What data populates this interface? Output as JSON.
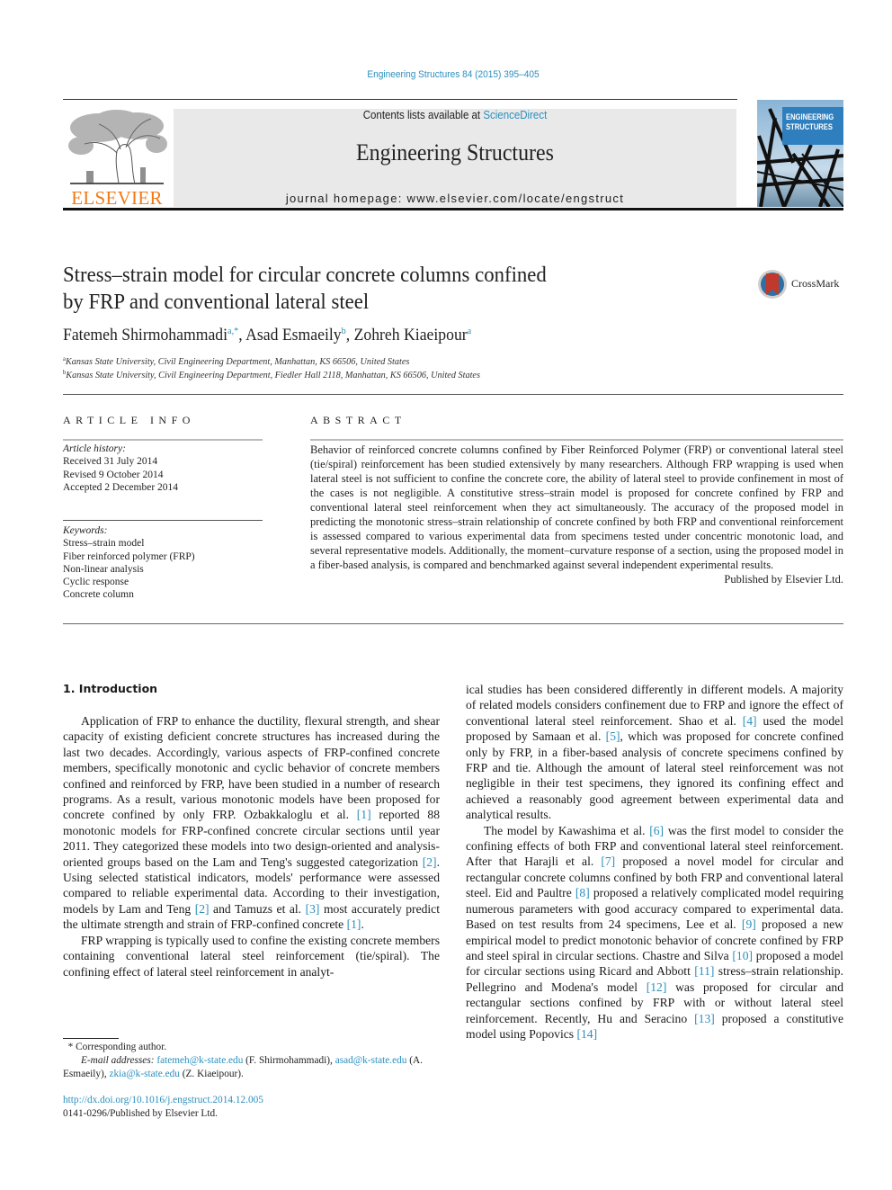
{
  "header": {
    "journal_ref": "Engineering Structures 84 (2015) 395–405",
    "contents_prefix": "Contents lists available at ",
    "contents_link": "ScienceDirect",
    "journal_name": "Engineering Structures",
    "homepage": "journal homepage: www.elsevier.com/locate/engstruct",
    "publisher_logo": "ELSEVIER",
    "cover_title_line1": "ENGINEERING",
    "cover_title_line2": "STRUCTURES",
    "crossmark_label": "CrossMark"
  },
  "article": {
    "title_line1": "Stress–strain model for circular concrete columns confined",
    "title_line2": "by FRP and conventional lateral steel",
    "authors": [
      {
        "name": "Fatemeh Shirmohammadi",
        "sup": "a,*"
      },
      {
        "name": "Asad Esmaeily",
        "sup": "b"
      },
      {
        "name": "Zohreh Kiaeipour",
        "sup": "a"
      }
    ],
    "affiliations": [
      {
        "key": "a",
        "text": "Kansas State University, Civil Engineering Department, Manhattan, KS 66506, United States"
      },
      {
        "key": "b",
        "text": "Kansas State University, Civil Engineering Department, Fiedler Hall 2118, Manhattan, KS 66506, United States"
      }
    ]
  },
  "article_info": {
    "heading": "ARTICLE INFO",
    "history_label": "Article history:",
    "history": [
      "Received 31 July 2014",
      "Revised 9 October 2014",
      "Accepted 2 December 2014"
    ],
    "keywords_label": "Keywords:",
    "keywords": [
      "Stress–strain model",
      "Fiber reinforced polymer (FRP)",
      "Non-linear analysis",
      "Cyclic response",
      "Concrete column"
    ]
  },
  "abstract": {
    "heading": "ABSTRACT",
    "text": "Behavior of reinforced concrete columns confined by Fiber Reinforced Polymer (FRP) or conventional lateral steel (tie/spiral) reinforcement has been studied extensively by many researchers. Although FRP wrapping is used when lateral steel is not sufficient to confine the concrete core, the ability of lateral steel to provide confinement in most of the cases is not negligible. A constitutive stress–strain model is proposed for concrete confined by FRP and conventional lateral steel reinforcement when they act simultaneously. The accuracy of the proposed model in predicting the monotonic stress–strain relationship of concrete confined by both FRP and conventional reinforcement is assessed compared to various experimental data from specimens tested under concentric monotonic load, and several representative models. Additionally, the moment–curvature response of a section, using the proposed model in a fiber-based analysis, is compared and benchmarked against several independent experimental results.",
    "published_by": "Published by Elsevier Ltd."
  },
  "body": {
    "section_heading": "1. Introduction",
    "left_paragraphs": [
      [
        {
          "t": "Application of FRP to enhance the ductility, flexural strength, and shear capacity of existing deficient concrete structures has increased during the last two decades. Accordingly, various aspects of FRP-confined concrete members, specifically monotonic and cyclic behavior of concrete members confined and reinforced by FRP, have been studied in a number of research programs. As a result, various monotonic models have been proposed for concrete confined by only FRP. Ozbakkaloglu et al. "
        },
        {
          "ref": "[1]"
        },
        {
          "t": " reported 88 monotonic models for FRP-confined concrete circular sections until year 2011. They categorized these models into two design-oriented and analysis-oriented groups based on the Lam and Teng's suggested categorization "
        },
        {
          "ref": "[2]"
        },
        {
          "t": ". Using selected statistical indicators, models' performance were assessed compared to reliable experimental data. According to their investigation, models by Lam and Teng "
        },
        {
          "ref": "[2]"
        },
        {
          "t": " and Tamuzs et al. "
        },
        {
          "ref": "[3]"
        },
        {
          "t": " most accurately predict the ultimate strength and strain of FRP-confined concrete "
        },
        {
          "ref": "[1]"
        },
        {
          "t": "."
        }
      ],
      [
        {
          "t": "FRP wrapping is typically used to confine the existing concrete members containing conventional lateral steel reinforcement (tie/spiral). The confining effect of lateral steel reinforcement in analyt-"
        }
      ]
    ],
    "right_paragraphs": [
      [
        {
          "t": "ical studies has been considered differently in different models. A majority of related models considers confinement due to FRP and ignore the effect of conventional lateral steel reinforcement. Shao et al. "
        },
        {
          "ref": "[4]"
        },
        {
          "t": " used the model proposed by Samaan et al. "
        },
        {
          "ref": "[5]"
        },
        {
          "t": ", which was proposed for concrete confined only by FRP, in a fiber-based analysis of concrete specimens confined by FRP and tie. Although the amount of lateral steel reinforcement was not negligible in their test specimens, they ignored its confining effect and achieved a reasonably good agreement between experimental data and analytical results."
        }
      ],
      [
        {
          "t": "The model by Kawashima et al. "
        },
        {
          "ref": "[6]"
        },
        {
          "t": " was the first model to consider the confining effects of both FRP and conventional lateral steel reinforcement. After that Harajli et al. "
        },
        {
          "ref": "[7]"
        },
        {
          "t": " proposed a novel model for circular and rectangular concrete columns confined by both FRP and conventional lateral steel. Eid and Paultre "
        },
        {
          "ref": "[8]"
        },
        {
          "t": " proposed a relatively complicated model requiring numerous parameters with good accuracy compared to experimental data. Based on test results from 24 specimens, Lee et al. "
        },
        {
          "ref": "[9]"
        },
        {
          "t": " proposed a new empirical model to predict monotonic behavior of concrete confined by FRP and steel spiral in circular sections. Chastre and Silva "
        },
        {
          "ref": "[10]"
        },
        {
          "t": " proposed a model for circular sections using Ricard and Abbott "
        },
        {
          "ref": "[11]"
        },
        {
          "t": " stress–strain relationship. Pellegrino and Modena's model "
        },
        {
          "ref": "[12]"
        },
        {
          "t": " was proposed for circular and rectangular sections confined by FRP with or without lateral steel reinforcement. Recently, Hu and Seracino "
        },
        {
          "ref": "[13]"
        },
        {
          "t": " proposed a constitutive model using Popovics "
        },
        {
          "ref": "[14]"
        }
      ]
    ]
  },
  "footnotes": {
    "corresponding_marker": "*",
    "corresponding_text": "Corresponding author.",
    "email_label": "E-mail addresses:",
    "emails": [
      {
        "email": "fatemeh@k-state.edu",
        "name": "(F. Shirmohammadi)"
      },
      {
        "email": "asad@k-state.edu",
        "name": "(A. Esmaeily)"
      },
      {
        "email": "zkia@k-state.edu",
        "name": "(Z. Kiaeipour)"
      }
    ],
    "doi": "http://dx.doi.org/10.1016/j.engstruct.2014.12.005",
    "issn_line": "0141-0296/Published by Elsevier Ltd."
  },
  "colors": {
    "link": "#2a8fbd",
    "elsevier_orange": "#f07a16",
    "header_band": "#e9e9e9"
  }
}
